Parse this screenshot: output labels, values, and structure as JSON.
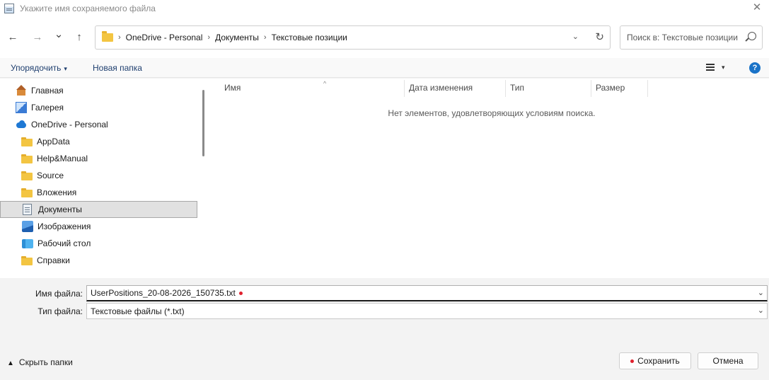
{
  "window": {
    "title": "Укажите имя сохраняемого файла",
    "app_icon": "notepad-icon",
    "close_glyph": "✕"
  },
  "nav": {
    "back_glyph": "←",
    "forward_glyph": "→",
    "recent_glyph": "⌄",
    "up_glyph": "↑",
    "breadcrumb_sep": "›",
    "breadcrumbs": [
      "OneDrive - Personal",
      "Документы",
      "Текстовые позиции"
    ],
    "dropdown_glyph": "⌄",
    "refresh_glyph": "↻"
  },
  "search": {
    "placeholder": "Поиск в: Текстовые позиции"
  },
  "toolbar": {
    "organize_label": "Упорядочить",
    "new_folder_label": "Новая папка",
    "caret": "▾",
    "help_glyph": "?"
  },
  "sidebar": {
    "items": [
      {
        "label": "Главная",
        "icon": "home-icon"
      },
      {
        "label": "Галерея",
        "icon": "gallery-icon"
      },
      {
        "label": "OneDrive - Personal",
        "icon": "onedrive-cloud-icon"
      },
      {
        "label": "AppData",
        "icon": "folder-icon"
      },
      {
        "label": "Help&Manual",
        "icon": "folder-icon"
      },
      {
        "label": "Source",
        "icon": "folder-icon"
      },
      {
        "label": "Вложения",
        "icon": "folder-icon"
      },
      {
        "label": "Документы",
        "icon": "documents-icon",
        "selected": true
      },
      {
        "label": "Изображения",
        "icon": "pictures-icon"
      },
      {
        "label": "Рабочий стол",
        "icon": "desktop-icon"
      },
      {
        "label": "Справки",
        "icon": "folder-icon"
      }
    ]
  },
  "filelist": {
    "columns": [
      "Имя",
      "Дата изменения",
      "Тип",
      "Размер"
    ],
    "sort_glyph": "^",
    "empty_message": "Нет элементов, удовлетворяющих условиям поиска."
  },
  "form": {
    "filename_label": "Имя файла:",
    "filename_value": "UserPositions_20-08-2026_150735.txt",
    "filetype_label": "Тип файла:",
    "filetype_value": "Текстовые файлы (*.txt)",
    "dropdown_glyph": "⌄"
  },
  "footer": {
    "hide_folders_label": "Скрыть папки",
    "hide_chevron": "▲",
    "save_label": "Сохранить",
    "cancel_label": "Отмена"
  },
  "colors": {
    "accent_blue": "#1a73c8",
    "command_text": "#1f3f6f",
    "required_dot": "#e0212e",
    "selected_bg": "#e1e1e1"
  }
}
